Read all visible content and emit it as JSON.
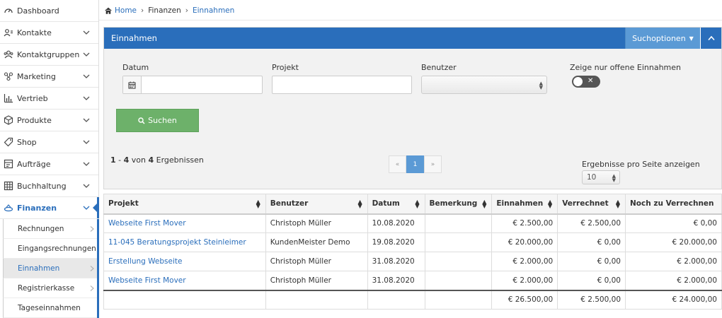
{
  "sidebar": {
    "items": [
      {
        "label": "Dashboard",
        "icon": "dashboard-icon"
      },
      {
        "label": "Kontakte",
        "icon": "contacts-icon"
      },
      {
        "label": "Kontaktgruppen",
        "icon": "contact-groups-icon"
      },
      {
        "label": "Marketing",
        "icon": "marketing-icon"
      },
      {
        "label": "Vertrieb",
        "icon": "sales-chart-icon"
      },
      {
        "label": "Produkte",
        "icon": "box-icon"
      },
      {
        "label": "Shop",
        "icon": "tag-icon"
      },
      {
        "label": "Aufträge",
        "icon": "orders-icon"
      },
      {
        "label": "Buchhaltung",
        "icon": "accounting-icon"
      },
      {
        "label": "Finanzen",
        "icon": "finance-icon"
      }
    ],
    "sub_items": [
      {
        "label": "Rechnungen"
      },
      {
        "label": "Eingangsrechnungen"
      },
      {
        "label": "Einnahmen"
      },
      {
        "label": "Registrierkasse"
      },
      {
        "label": "Tageseinnahmen"
      }
    ]
  },
  "breadcrumb": {
    "home": "Home",
    "section": "Finanzen",
    "current": "Einnahmen"
  },
  "panel": {
    "title": "Einnahmen",
    "search_options": "Suchoptionen",
    "filters": {
      "datum_label": "Datum",
      "projekt_label": "Projekt",
      "benutzer_label": "Benutzer",
      "offene_label": "Zeige nur offene Einnahmen"
    },
    "search_button": "Suchen",
    "results": {
      "from": "1",
      "to": "4",
      "von": "von",
      "total": "4",
      "suffix": "Ergebnissen"
    },
    "pager": {
      "prev": "«",
      "current": "1",
      "next": "»"
    },
    "per_page_label": "Ergebnisse pro Seite anzeigen",
    "per_page_value": "10"
  },
  "table": {
    "headers": [
      "Projekt",
      "Benutzer",
      "Datum",
      "Bemerkung",
      "Einnahmen",
      "Verrechnet",
      "Noch zu Verrechnen"
    ],
    "rows": [
      {
        "projekt": "Webseite First Mover",
        "benutzer": "Christoph Müller",
        "datum": "10.08.2020",
        "bemerkung": "",
        "einnahmen": "€ 2.500,00",
        "verrechnet": "€ 2.500,00",
        "offen": "€ 0,00"
      },
      {
        "projekt": "11-045 Beratungsprojekt Steinleimer",
        "benutzer": "KundenMeister Demo",
        "datum": "19.08.2020",
        "bemerkung": "",
        "einnahmen": "€ 20.000,00",
        "verrechnet": "€ 0,00",
        "offen": "€ 20.000,00"
      },
      {
        "projekt": "Erstellung Webseite",
        "benutzer": "Christoph Müller",
        "datum": "31.08.2020",
        "bemerkung": "",
        "einnahmen": "€ 2.000,00",
        "verrechnet": "€ 0,00",
        "offen": "€ 2.000,00"
      },
      {
        "projekt": "Webseite First Mover",
        "benutzer": "Christoph Müller",
        "datum": "31.08.2020",
        "bemerkung": "",
        "einnahmen": "€ 2.000,00",
        "verrechnet": "€ 0,00",
        "offen": "€ 2.000,00"
      }
    ],
    "totals": {
      "einnahmen": "€ 26.500,00",
      "verrechnet": "€ 2.500,00",
      "offen": "€ 24.000,00"
    }
  },
  "colors": {
    "primary": "#2a6ebb",
    "search_button": "#6db16a",
    "search_options": "#5b9ad5"
  }
}
